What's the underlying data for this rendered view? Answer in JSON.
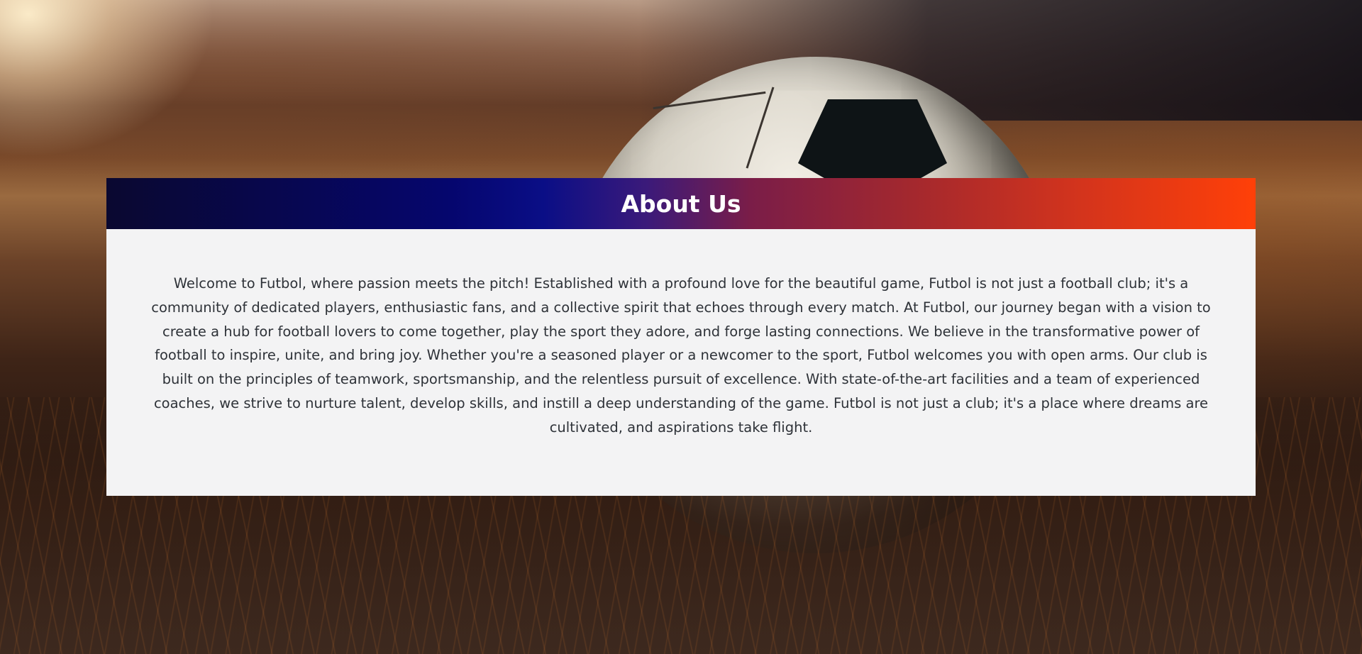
{
  "about": {
    "title": "About Us",
    "body": "Welcome to Futbol, where passion meets the pitch! Established with a profound love for the beautiful game, Futbol is not just a football club; it's a community of dedicated players, enthusiastic fans, and a collective spirit that echoes through every match. At Futbol, our journey began with a vision to create a hub for football lovers to come together, play the sport they adore, and forge lasting connections. We believe in the transformative power of football to inspire, unite, and bring joy. Whether you're a seasoned player or a newcomer to the sport, Futbol welcomes you with open arms. Our club is built on the principles of teamwork, sportsmanship, and the relentless pursuit of excellence. With state-of-the-art facilities and a team of experienced coaches, we strive to nurture talent, develop skills, and instill a deep understanding of the game. Futbol is not just a club; it's a place where dreams are cultivated, and aspirations take flight."
  },
  "colors": {
    "header_gradient_start": "#0a0830",
    "header_gradient_mid": "#05066e",
    "header_gradient_end": "#ff4008",
    "card_background": "#f3f3f4",
    "body_text": "#2e3238"
  }
}
